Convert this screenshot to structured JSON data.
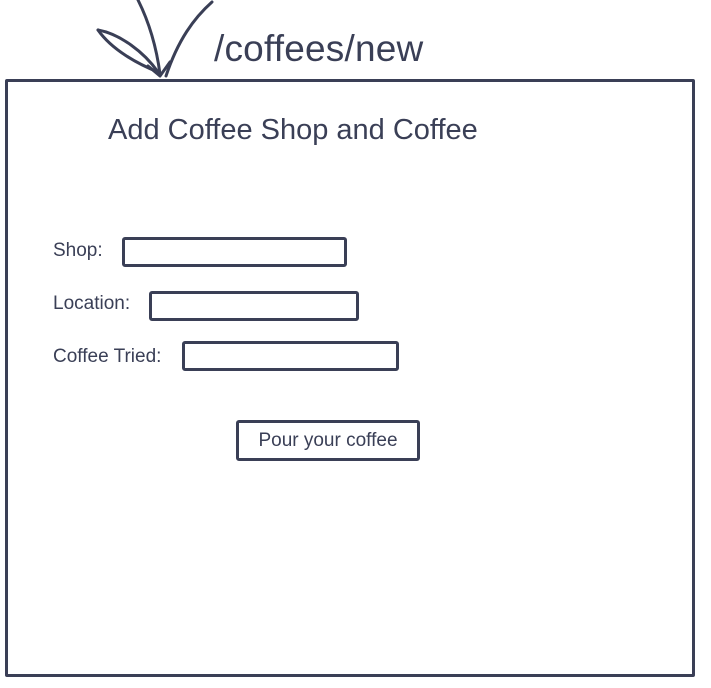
{
  "route": {
    "path": "/coffees/new"
  },
  "page": {
    "title": "Add Coffee Shop and Coffee"
  },
  "form": {
    "shop": {
      "label": "Shop:",
      "value": ""
    },
    "location": {
      "label": "Location:",
      "value": ""
    },
    "coffee_tried": {
      "label": "Coffee Tried:",
      "value": ""
    },
    "submit_label": "Pour your coffee"
  },
  "icons": {
    "route_pointer": "hand-drawn-arrow-icon"
  },
  "colors": {
    "ink": "#3a3f56",
    "background": "#ffffff"
  }
}
